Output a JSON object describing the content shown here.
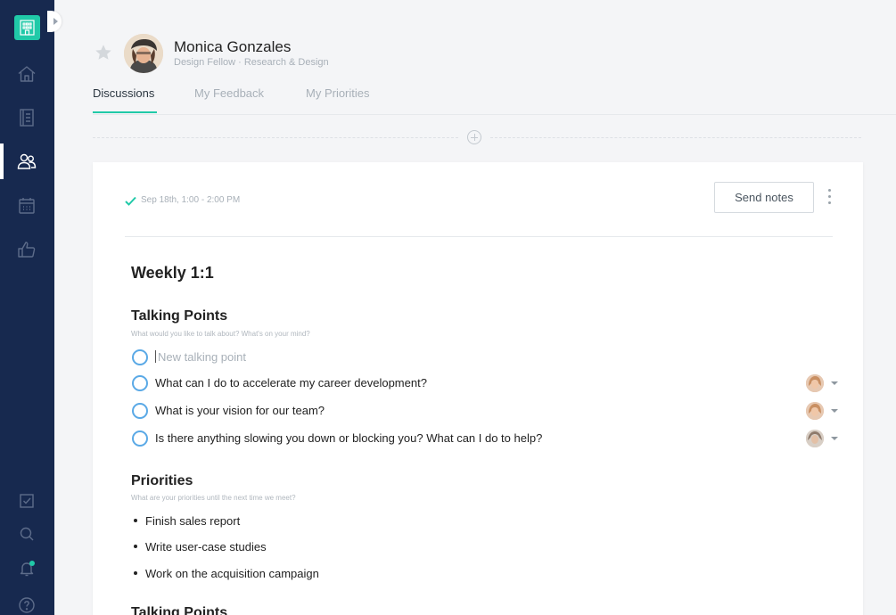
{
  "sidebar": {
    "logo_icon": "building-icon",
    "nav": [
      {
        "icon": "home-icon"
      },
      {
        "icon": "notebook-icon"
      },
      {
        "icon": "people-icon",
        "active": true
      },
      {
        "icon": "calendar-icon"
      },
      {
        "icon": "thumbs-up-icon"
      }
    ],
    "bottom": [
      {
        "icon": "checkbox-icon"
      },
      {
        "icon": "search-icon"
      },
      {
        "icon": "bell-icon"
      },
      {
        "icon": "help-icon"
      }
    ]
  },
  "profile": {
    "name": "Monica Gonzales",
    "role": "Design Fellow · Research & Design"
  },
  "tabs": [
    {
      "label": "Discussions",
      "active": true
    },
    {
      "label": "My Feedback",
      "active": false
    },
    {
      "label": "My Priorities",
      "active": false
    }
  ],
  "meeting": {
    "date": "Sep 18th, 1:00 - 2:00 PM",
    "send_label": "Send notes",
    "title": "Weekly 1:1"
  },
  "talking_points": {
    "title": "Talking Points",
    "subtitle": "What would you like to talk about? What's on your mind?",
    "placeholder": "New talking point",
    "items": [
      "What can I do to accelerate my career development?",
      "What is your vision for our team?",
      "Is there anything slowing you down or blocking you? What can I do to help?"
    ]
  },
  "priorities": {
    "title": "Priorities",
    "subtitle": "What are your priorities until the next time we meet?",
    "items": [
      "Finish sales report",
      "Write user-case studies",
      "Work on the acquisition campaign"
    ]
  },
  "next_section_title": "Talking Points",
  "colors": {
    "sidebar": "#17294f",
    "accent": "#20c9a8",
    "checkbox": "#5aa9e6"
  }
}
